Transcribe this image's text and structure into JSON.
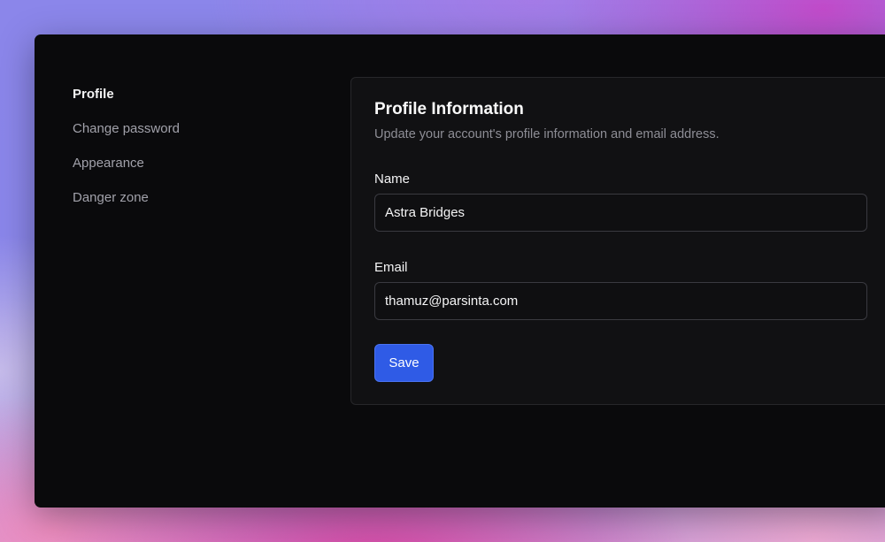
{
  "sidebar": {
    "items": [
      {
        "label": "Profile",
        "active": true
      },
      {
        "label": "Change password",
        "active": false
      },
      {
        "label": "Appearance",
        "active": false
      },
      {
        "label": "Danger zone",
        "active": false
      }
    ]
  },
  "profile": {
    "title": "Profile Information",
    "subtitle": "Update your account's profile information and email address.",
    "name_label": "Name",
    "name_value": "Astra Bridges",
    "email_label": "Email",
    "email_value": "thamuz@parsinta.com",
    "save_label": "Save"
  },
  "colors": {
    "accent": "#2f5be6",
    "window_bg": "#0a0a0c",
    "card_bg": "#111113"
  }
}
